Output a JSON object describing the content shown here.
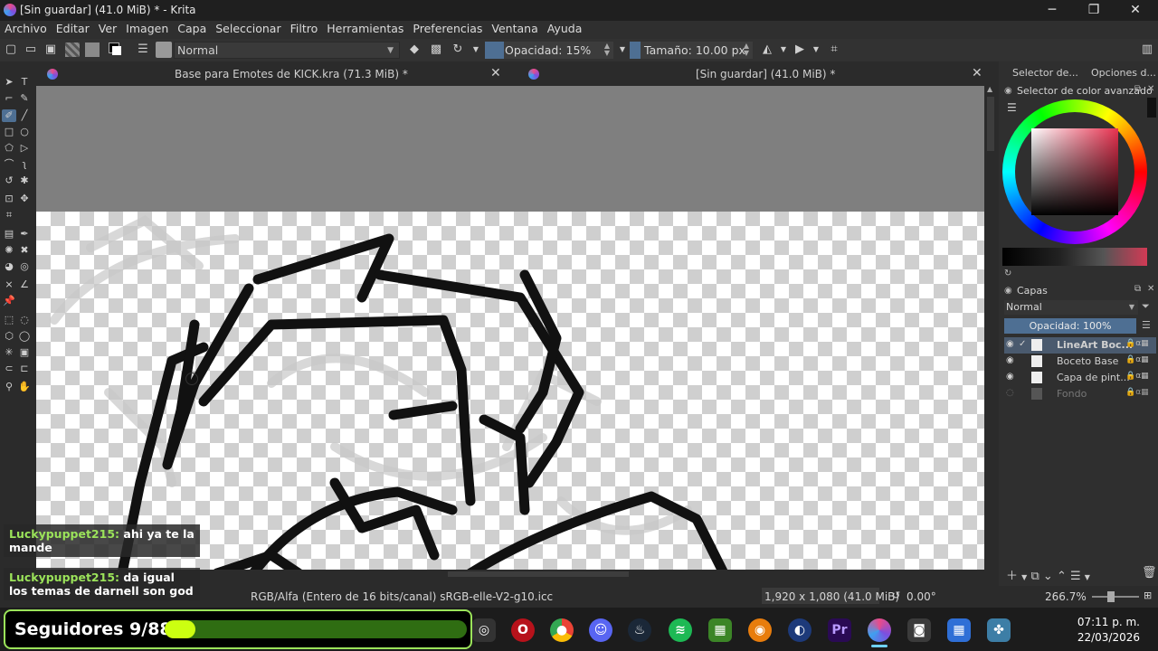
{
  "window": {
    "title": "[Sin guardar]  (41.0 MiB) * - Krita",
    "minimize": "─",
    "maximize": "❐",
    "close": "✕"
  },
  "menu": [
    "Archivo",
    "Editar",
    "Ver",
    "Imagen",
    "Capa",
    "Seleccionar",
    "Filtro",
    "Herramientas",
    "Preferencias",
    "Ventana",
    "Ayuda"
  ],
  "toolbar": {
    "blend_mode": "Normal",
    "opacity_label": "Opacidad: 15%",
    "opacity_value": 0.15,
    "size_label": "Tamaño: 10.00 px"
  },
  "tabs": [
    {
      "label": "Base para Emotes de KICK.kra (71.3 MiB) *",
      "close": "✕"
    },
    {
      "label": "[Sin guardar]  (41.0 MiB) *",
      "close": "✕"
    }
  ],
  "docker": {
    "tabs": [
      "Selector de...",
      "Opciones d..."
    ],
    "color_selector_title": "Selector de color avanzado",
    "layers_title": "Capas",
    "layers_blend": "Normal",
    "layers_opacity": "Opacidad:  100%",
    "layers": [
      {
        "name": "LineArt Boc...",
        "visible": true,
        "active": true
      },
      {
        "name": "Boceto Base",
        "visible": true,
        "active": false
      },
      {
        "name": "Capa de pint...",
        "visible": true,
        "active": false
      },
      {
        "name": "Fondo",
        "visible": false,
        "active": false
      }
    ]
  },
  "status": {
    "color_space": "RGB/Alfa (Entero de 16 bits/canal)  sRGB-elle-V2-g10.icc",
    "dimensions": "1,920 x 1,080 (41.0 MiB)",
    "rotation": "0.00°",
    "zoom": "266.7%"
  },
  "chat": [
    {
      "user": "Luckypuppet215:",
      "text": " ahi ya te la mande"
    },
    {
      "user": "Luckypuppet215:",
      "text": " da igual los temas de darnell son god"
    }
  ],
  "followers": {
    "label": "Seguidores 9/88",
    "progress": 0.102
  },
  "taskbar": {
    "time": "07:11 p. m.",
    "date": "22/03/2026"
  }
}
